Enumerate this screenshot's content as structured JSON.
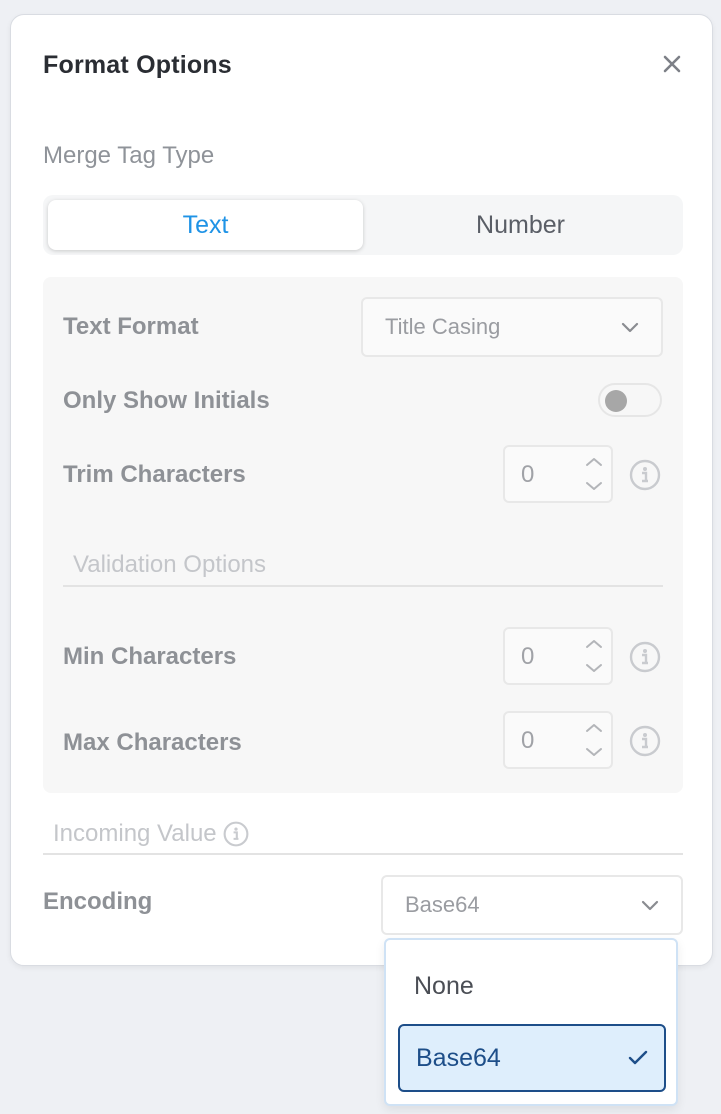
{
  "dialog": {
    "title": "Format Options",
    "close_icon": "close-icon"
  },
  "merge_tag": {
    "label": "Merge Tag Type",
    "options": [
      "Text",
      "Number"
    ],
    "selected": "Text"
  },
  "text_options": {
    "text_format": {
      "label": "Text Format",
      "value": "Title Casing"
    },
    "only_initials": {
      "label": "Only Show Initials",
      "on": false
    },
    "trim": {
      "label": "Trim Characters",
      "value": "0"
    },
    "validation_heading": "Validation Options",
    "min_chars": {
      "label": "Min Characters",
      "value": "0"
    },
    "max_chars": {
      "label": "Max Characters",
      "value": "0"
    }
  },
  "incoming_value": {
    "label": "Incoming Value"
  },
  "encoding": {
    "label": "Encoding",
    "value": "Base64",
    "options": [
      "None",
      "Base64"
    ],
    "selected": "Base64"
  },
  "colors": {
    "accent": "#1f93e6",
    "selected_option_bg": "#deeefc",
    "selected_option_border": "#1d4e89"
  }
}
